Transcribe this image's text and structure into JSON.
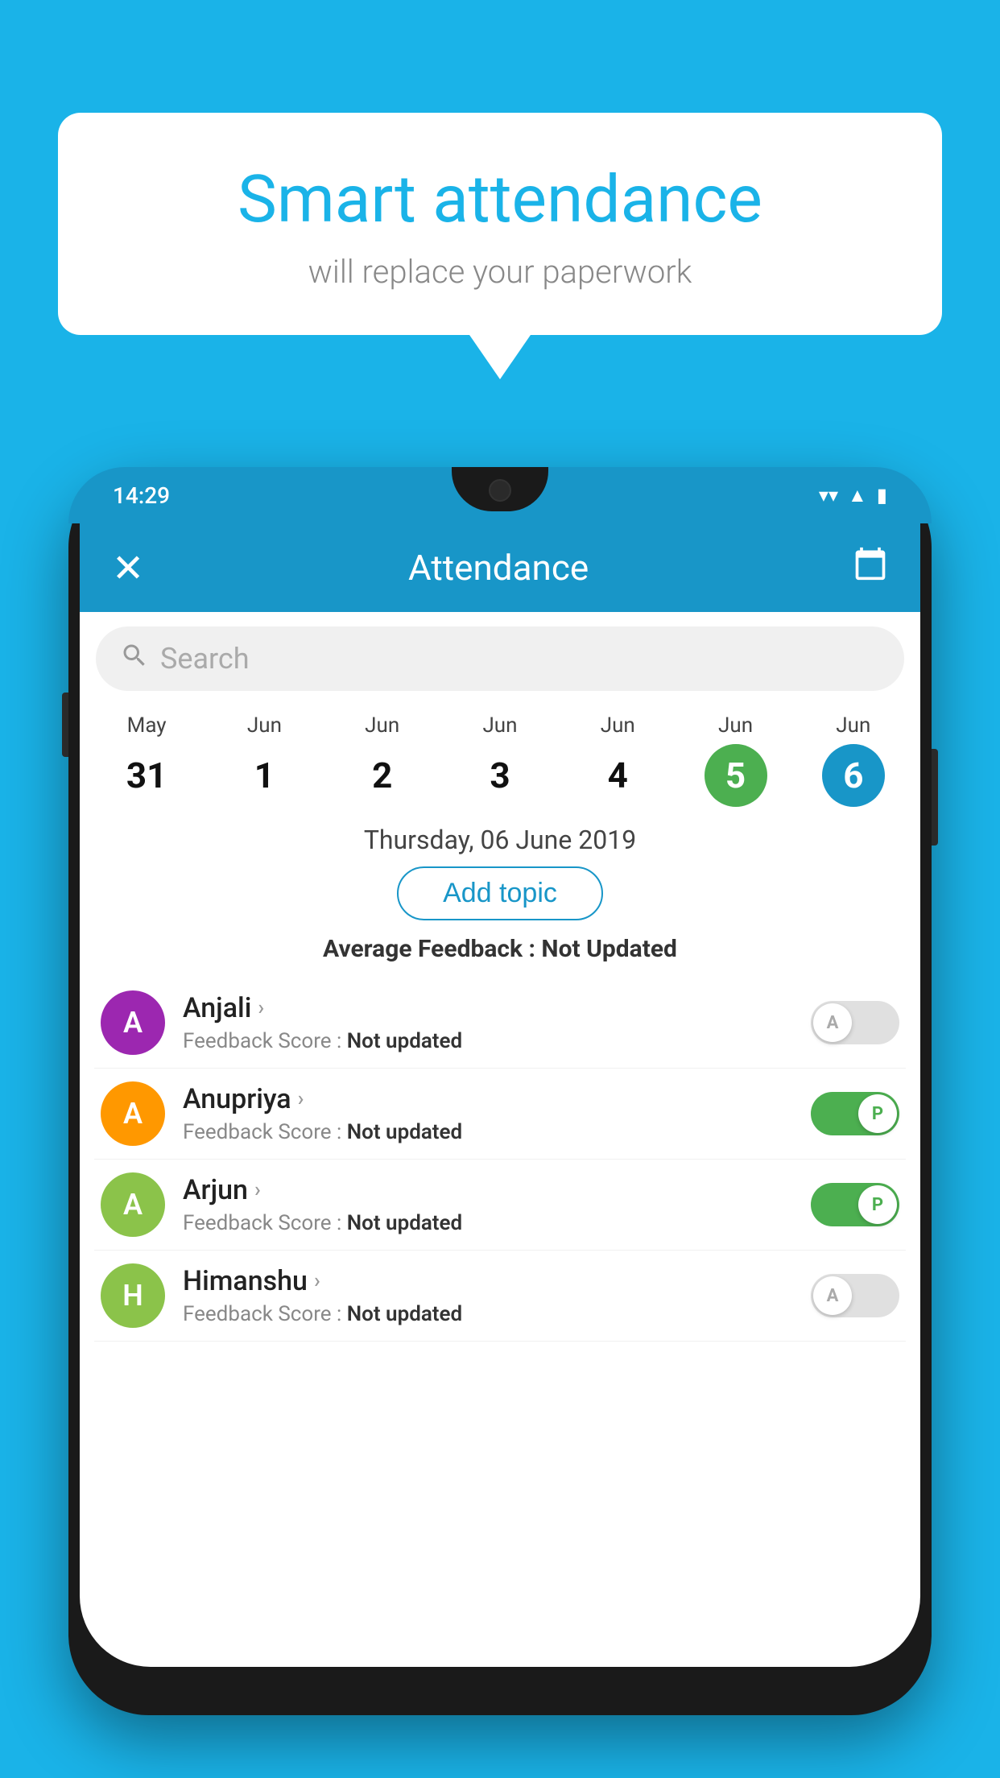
{
  "background_color": "#1ab3e8",
  "speech_bubble": {
    "title": "Smart attendance",
    "subtitle": "will replace your paperwork"
  },
  "phone": {
    "status_bar": {
      "time": "14:29",
      "icons": [
        "wifi",
        "signal",
        "battery"
      ]
    },
    "header": {
      "title": "Attendance",
      "close_label": "✕",
      "calendar_icon": "calendar"
    },
    "search": {
      "placeholder": "Search"
    },
    "dates": [
      {
        "month": "May",
        "day": "31",
        "state": "normal"
      },
      {
        "month": "Jun",
        "day": "1",
        "state": "normal"
      },
      {
        "month": "Jun",
        "day": "2",
        "state": "normal"
      },
      {
        "month": "Jun",
        "day": "3",
        "state": "normal"
      },
      {
        "month": "Jun",
        "day": "4",
        "state": "normal"
      },
      {
        "month": "Jun",
        "day": "5",
        "state": "today"
      },
      {
        "month": "Jun",
        "day": "6",
        "state": "selected"
      }
    ],
    "selected_date_label": "Thursday, 06 June 2019",
    "add_topic_label": "Add topic",
    "avg_feedback_prefix": "Average Feedback : ",
    "avg_feedback_value": "Not Updated",
    "students": [
      {
        "name": "Anjali",
        "avatar_letter": "A",
        "avatar_color": "#9c27b0",
        "feedback_label": "Feedback Score : ",
        "feedback_value": "Not updated",
        "attendance": "absent",
        "toggle_letter": "A"
      },
      {
        "name": "Anupriya",
        "avatar_letter": "A",
        "avatar_color": "#ff9800",
        "feedback_label": "Feedback Score : ",
        "feedback_value": "Not updated",
        "attendance": "present",
        "toggle_letter": "P"
      },
      {
        "name": "Arjun",
        "avatar_letter": "A",
        "avatar_color": "#8bc34a",
        "feedback_label": "Feedback Score : ",
        "feedback_value": "Not updated",
        "attendance": "present",
        "toggle_letter": "P"
      },
      {
        "name": "Himanshu",
        "avatar_letter": "H",
        "avatar_color": "#8bc34a",
        "feedback_label": "Feedback Score : ",
        "feedback_value": "Not updated",
        "attendance": "absent",
        "toggle_letter": "A"
      }
    ]
  }
}
